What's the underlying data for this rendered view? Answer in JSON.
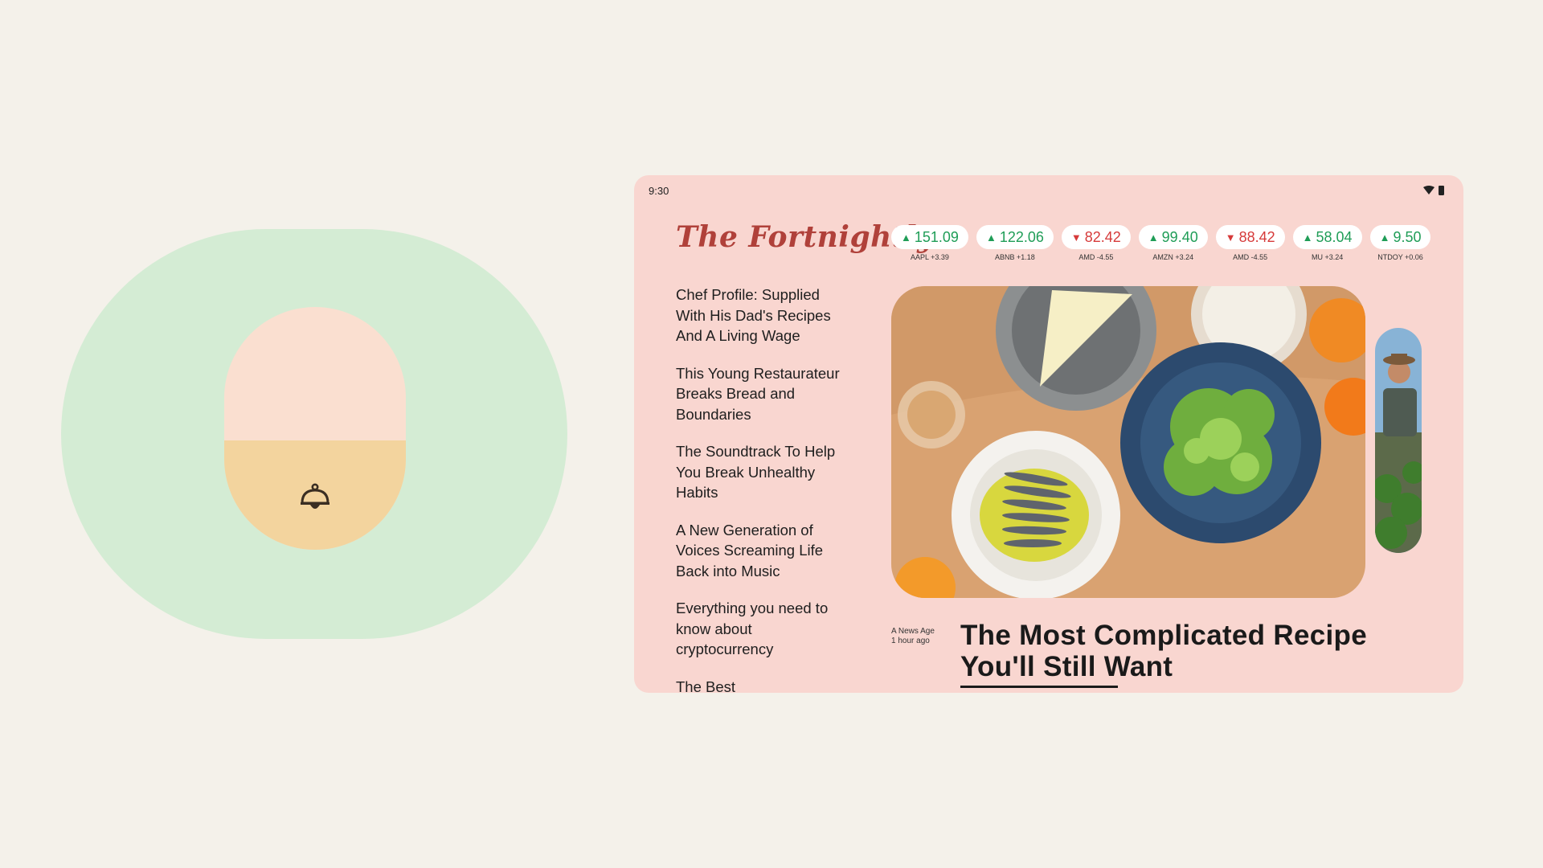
{
  "illustration": {
    "outer_color": "#d4ecd4",
    "inner_color": "#fadfd0",
    "fill_color": "#f3d49e",
    "fill_level": 0.45,
    "icon": "bell-icon"
  },
  "tablet": {
    "status": {
      "time": "9:30",
      "icons": [
        "wifi-icon",
        "battery-icon"
      ]
    },
    "masthead": "The Fortnightly",
    "ticker": [
      {
        "value": "151.09",
        "direction": "up",
        "label": "AAPL +3.39"
      },
      {
        "value": "122.06",
        "direction": "up",
        "label": "ABNB +1.18"
      },
      {
        "value": "82.42",
        "direction": "down",
        "label": "AMD -4.55"
      },
      {
        "value": "99.40",
        "direction": "up",
        "label": "AMZN +3.24"
      },
      {
        "value": "88.42",
        "direction": "down",
        "label": "AMD -4.55"
      },
      {
        "value": "58.04",
        "direction": "up",
        "label": "MU +3.24"
      },
      {
        "value": "9.50",
        "direction": "up",
        "label": "NTDOY +0.06"
      }
    ],
    "headlines": [
      "Chef Profile: Supplied With His Dad's Recipes And A Living Wage",
      "This Young Restaurateur Breaks Bread and Boundaries",
      "The Soundtrack To Help You Break Unhealthy Habits",
      "A New Generation of Voices Screaming Life Back into Music",
      "Everything you need to know about cryptocurrency",
      "The Best"
    ],
    "featured": {
      "source": "A News Age",
      "time_ago": "1 hour ago",
      "title": "The Most Complicated Recipe You'll Still Want"
    },
    "colors": {
      "background": "#f9d6d0",
      "up": "#1f9d57",
      "down": "#d63a3a",
      "masthead": "#b0413a"
    }
  }
}
